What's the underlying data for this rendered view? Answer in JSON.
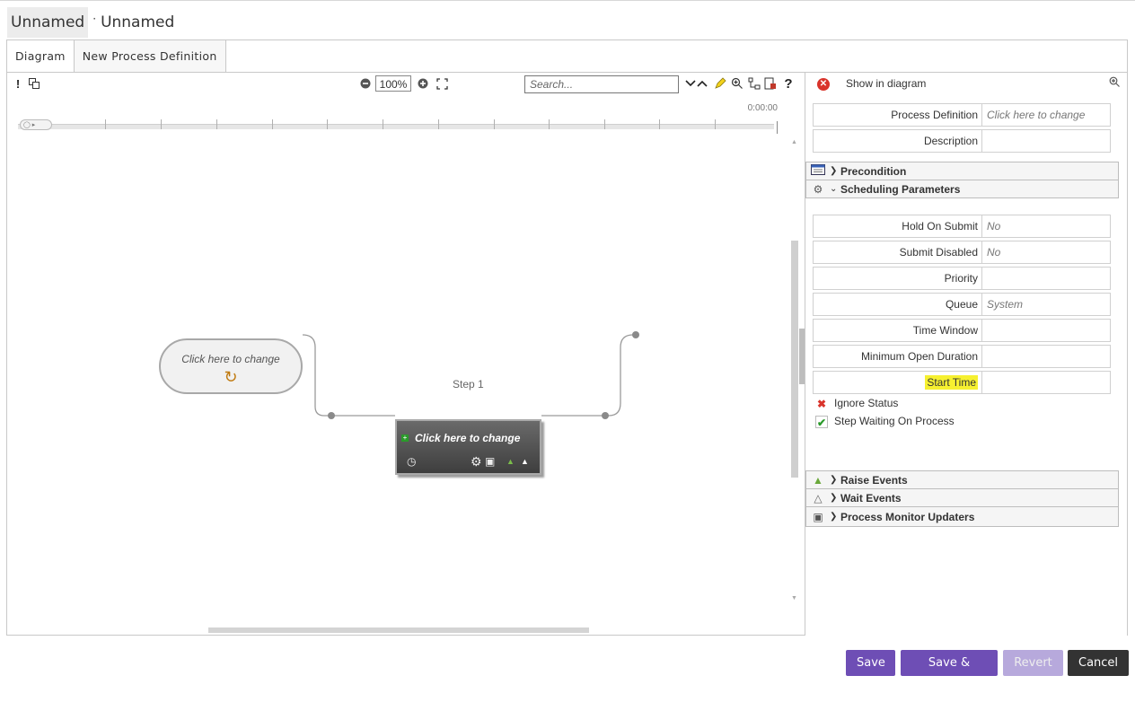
{
  "title": {
    "part1": "Unnamed",
    "separator": "·",
    "part2": "Unnamed"
  },
  "tabs": [
    {
      "label": "Diagram",
      "active": true
    },
    {
      "label": "New Process Definition",
      "active": false
    }
  ],
  "toolbar": {
    "zoom_value": "100%",
    "search_placeholder": "Search..."
  },
  "timeline": {
    "time": "0:00:00"
  },
  "diagram": {
    "start_node_label": "Click here to change",
    "step_label": "Step 1",
    "step_box_label": "Click here to change"
  },
  "panel": {
    "show_in_diagram": "Show in diagram",
    "top_props": [
      {
        "label": "Process Definition",
        "value": "Click here to change"
      },
      {
        "label": "Description",
        "value": ""
      }
    ],
    "sections_top": [
      {
        "name": "Precondition"
      },
      {
        "name": "Scheduling Parameters"
      }
    ],
    "scheduling_props": [
      {
        "label": "Hold On Submit",
        "value": "No"
      },
      {
        "label": "Submit Disabled",
        "value": "No"
      },
      {
        "label": "Priority",
        "value": ""
      },
      {
        "label": "Queue",
        "value": "System"
      },
      {
        "label": "Time Window",
        "value": ""
      },
      {
        "label": "Minimum Open Duration",
        "value": ""
      },
      {
        "label": "Start Time",
        "value": ""
      }
    ],
    "checks": [
      {
        "label": "Ignore Status",
        "checked": false
      },
      {
        "label": "Step Waiting On Process",
        "checked": true
      }
    ],
    "sections_bottom": [
      {
        "name": "Raise Events"
      },
      {
        "name": "Wait Events"
      },
      {
        "name": "Process Monitor Updaters"
      }
    ]
  },
  "buttons": {
    "save": "Save",
    "save_close": "Save & Close",
    "revert": "Revert",
    "cancel": "Cancel"
  },
  "colors": {
    "primary": "#6e4eb5",
    "primary_disabled": "#b7a9dc",
    "dark": "#333333",
    "highlight": "#f6f030",
    "close_red": "#d9342b",
    "check_green": "#2a9a2a"
  }
}
